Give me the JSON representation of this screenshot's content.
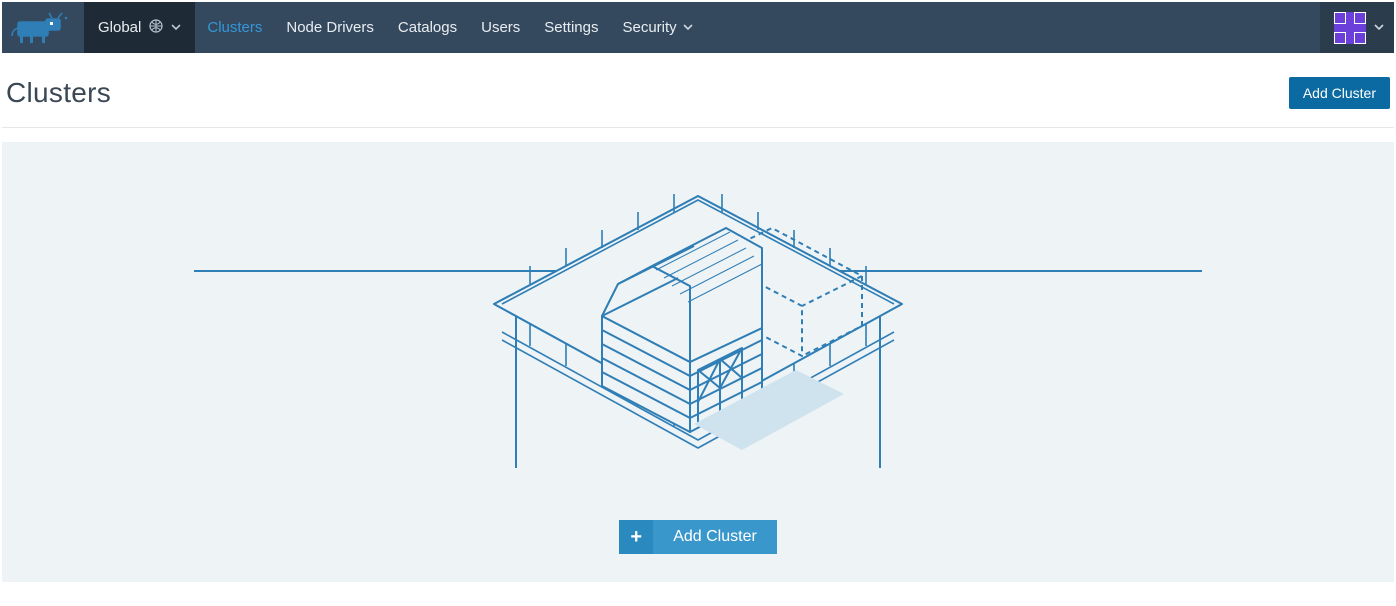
{
  "nav": {
    "scope_label": "Global",
    "tabs": [
      {
        "label": "Clusters",
        "active": true
      },
      {
        "label": "Node Drivers",
        "active": false
      },
      {
        "label": "Catalogs",
        "active": false
      },
      {
        "label": "Users",
        "active": false
      },
      {
        "label": "Settings",
        "active": false
      },
      {
        "label": "Security",
        "active": false,
        "caret": true
      }
    ]
  },
  "header": {
    "title": "Clusters",
    "add_button_label": "Add Cluster"
  },
  "empty_state": {
    "add_button_label": "Add Cluster"
  },
  "colors": {
    "nav_bg": "#34495e",
    "nav_active": "#3497d9",
    "primary_button": "#0a6aa1",
    "tile_button": "#3a97cc",
    "panel_bg": "#eef3f6",
    "stroke": "#2f7eb5"
  }
}
